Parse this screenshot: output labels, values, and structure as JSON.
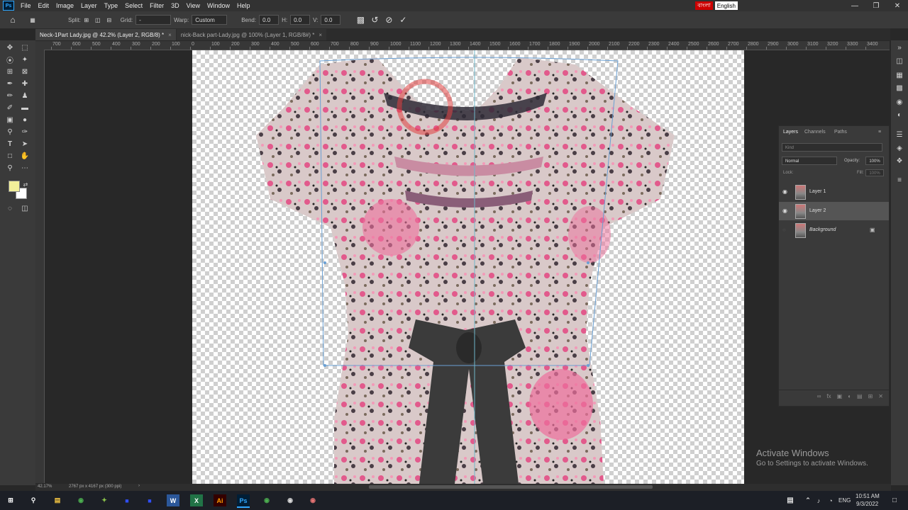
{
  "menu": {
    "app_logo": "Ps",
    "items": [
      "File",
      "Edit",
      "Image",
      "Layer",
      "Type",
      "Select",
      "Filter",
      "3D",
      "View",
      "Window",
      "Help"
    ],
    "ime_bangla": "বাংলা",
    "ime_english": "English"
  },
  "options": {
    "split_label": "Split:",
    "grid_label": "Grid:",
    "grid_value": "-",
    "warp_label": "Warp:",
    "warp_value": "Custom",
    "bend_label": "Bend:",
    "bend_value": "0.0",
    "h_label": "H:",
    "h_value": "0.0",
    "v_label": "V:",
    "v_value": "0.0"
  },
  "tabs": [
    {
      "label": "Neck-1Part Lady.jpg @ 42.2% (Layer 2, RGB/8) *",
      "close": "×"
    },
    {
      "label": "nick-Back part-Lady.jpg @ 100% (Layer 1, RGB/8#) *",
      "close": "×"
    }
  ],
  "ruler_top": [
    "700",
    "600",
    "500",
    "400",
    "300",
    "200",
    "100",
    "0",
    "100",
    "200",
    "300",
    "400",
    "500",
    "600",
    "700",
    "800",
    "900",
    "1000",
    "1100",
    "1200",
    "1300",
    "1400",
    "1500",
    "1600",
    "1700",
    "1800",
    "1900",
    "2000",
    "2100",
    "2200",
    "2300",
    "2400",
    "2500",
    "2600",
    "2700",
    "2800",
    "2900",
    "3000",
    "3100",
    "3200",
    "3300",
    "3400"
  ],
  "layers_panel": {
    "tabs": [
      "Layers",
      "Channels",
      "Paths"
    ],
    "kind_placeholder": "Kind",
    "blend_mode": "Normal",
    "opacity_label": "Opacity:",
    "opacity_value": "100%",
    "lock_label": "Lock:",
    "fill_label": "Fill:",
    "fill_value": "100%",
    "layers": [
      {
        "name": "Layer 1",
        "visible": true
      },
      {
        "name": "Layer 2",
        "visible": true,
        "selected": true
      },
      {
        "name": "Background",
        "visible": false,
        "locked": true
      }
    ]
  },
  "status": {
    "zoom": "42.17%",
    "doc_info": "2767 px x 4167 px (300 ppi)"
  },
  "watermark": {
    "title": "Activate Windows",
    "subtitle": "Go to Settings to activate Windows."
  },
  "taskbar": {
    "lang": "ENG",
    "time": "10:51 AM",
    "date": "9/3/2022"
  },
  "colors": {
    "foreground": "#f3f09a",
    "background": "#ffffff",
    "accent": "#31a8ff"
  }
}
